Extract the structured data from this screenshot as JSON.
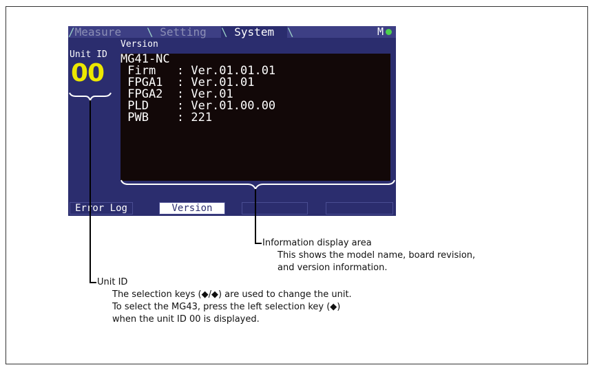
{
  "screen": {
    "tabs": [
      {
        "label": "Measure"
      },
      {
        "label": "Setting"
      },
      {
        "label": "System"
      }
    ],
    "status_indicator": "M",
    "page_title": "Version",
    "unit": {
      "label": "Unit ID",
      "value": "00"
    },
    "info_lines": [
      "MG41-NC",
      " Firm   : Ver.01.01.01",
      " FPGA1  : Ver.01.01",
      " FPGA2  : Ver.01",
      " PLD    : Ver.01.00.00",
      " PWB    : 221"
    ],
    "softkeys": [
      "Error Log",
      "Version",
      "",
      "",
      ""
    ]
  },
  "annotations": {
    "info_area": {
      "title": "Information display area",
      "lines": [
        "This shows the model name, board revision,",
        "and version information."
      ]
    },
    "unit_id": {
      "title": "Unit ID",
      "lines": [
        "The selection keys (◆/◆) are used to change the unit.",
        "To select the MG43, press the left selection key (◆)",
        "when the unit ID 00 is displayed."
      ]
    }
  },
  "colors": {
    "screen_bg": "#2b2d6e",
    "info_bg": "#120808",
    "unit_value": "#ece700",
    "status_dot": "#4cd14c"
  }
}
